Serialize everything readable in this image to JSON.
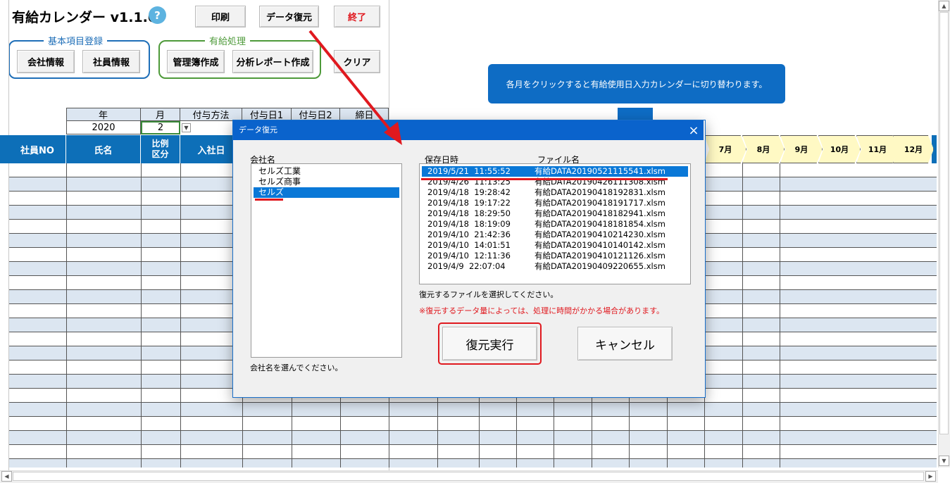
{
  "app": {
    "title": "有給カレンダー v1.1.0",
    "help_icon": "?",
    "buttons": {
      "print": "印刷",
      "restore": "データ復元",
      "exit": "終了",
      "clear": "クリア",
      "company_info": "会社情報",
      "employee_info": "社員情報",
      "ledger": "管理簿作成",
      "report": "分析レポート作成"
    },
    "groups": {
      "basic": "基本項目登録",
      "leave": "有給処理"
    },
    "banner": "各月をクリックすると有給使用日入力カレンダーに切り替わります。"
  },
  "settings": {
    "headers": [
      "年",
      "月",
      "付与方法",
      "付与日1",
      "付与日2",
      "締日"
    ],
    "values": [
      "2020",
      "2"
    ]
  },
  "table": {
    "headers": [
      "社員NO",
      "氏名",
      "比例\n区分",
      "入社日"
    ],
    "months": [
      "7月",
      "8月",
      "9月",
      "10月",
      "11月",
      "12月"
    ]
  },
  "dialog": {
    "title": "データ復元",
    "company_label": "会社名",
    "companies": [
      "セルズ工業",
      "セルズ商事",
      "セルズ"
    ],
    "selected_company": 2,
    "company_hint": "会社名を選んでください。",
    "file_headers": {
      "date": "保存日時",
      "name": "ファイル名"
    },
    "files": [
      {
        "date": "2019/5/21  11:55:52",
        "name": "有給DATA20190521115541.xlsm"
      },
      {
        "date": "2019/4/26  11:13:25",
        "name": "有給DATA20190426111308.xlsm"
      },
      {
        "date": "2019/4/18  19:28:42",
        "name": "有給DATA20190418192831.xlsm"
      },
      {
        "date": "2019/4/18  19:17:22",
        "name": "有給DATA20190418191717.xlsm"
      },
      {
        "date": "2019/4/18  18:29:50",
        "name": "有給DATA20190418182941.xlsm"
      },
      {
        "date": "2019/4/18  18:19:09",
        "name": "有給DATA20190418181854.xlsm"
      },
      {
        "date": "2019/4/10  21:42:36",
        "name": "有給DATA20190410214230.xlsm"
      },
      {
        "date": "2019/4/10  14:01:51",
        "name": "有給DATA20190410140142.xlsm"
      },
      {
        "date": "2019/4/10  12:11:36",
        "name": "有給DATA20190410121126.xlsm"
      },
      {
        "date": "2019/4/9  22:07:04",
        "name": "有給DATA20190409220655.xlsm"
      }
    ],
    "selected_file": 0,
    "file_hint": "復元するファイルを選択してください。",
    "warning": "※復元するデータ量によっては、処理に時間がかかる場合があります。",
    "execute": "復元実行",
    "cancel": "キャンセル",
    "close_icon": "×"
  },
  "colors": {
    "header_blue": "#0d6fb8",
    "row_alt": "#dce6f1",
    "month_fill": "#fff9c4",
    "banner": "#0e6cc4",
    "dialog_title": "#0a63cc",
    "selection": "#0a78d7",
    "annotation": "#e0191f",
    "group_basic": "#1f6fb8",
    "group_leave": "#4e9a3a"
  },
  "icons": {
    "close": "close-icon",
    "help": "help-icon",
    "scroll_up": "scroll-up-icon",
    "scroll_down": "scroll-down-icon",
    "scroll_left": "scroll-left-icon",
    "scroll_right": "scroll-right-icon",
    "dropdown": "dropdown-arrow-icon"
  }
}
